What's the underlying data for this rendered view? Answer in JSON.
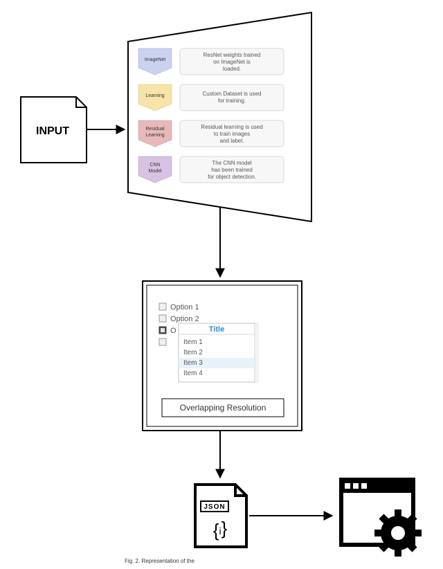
{
  "input": {
    "label": "INPUT"
  },
  "stages": [
    {
      "name": "ImageNet",
      "desc1": "ResNet weights trained",
      "desc2": "on ImageNet is",
      "desc3": "loaded."
    },
    {
      "name": "Learning",
      "desc1": "Custom Dataset is used",
      "desc2": "for training.",
      "desc3": ""
    },
    {
      "name": "Residual",
      "name2": "Learning",
      "desc1": "Residual learning is used",
      "desc2": "to train images",
      "desc3": "and label."
    },
    {
      "name": "CNN",
      "name2": "Model",
      "desc1": "The CNN model",
      "desc2": "has been trained",
      "desc3": "for object detection."
    }
  ],
  "colors": {
    "stage0": "#cbd2f0",
    "stage1": "#f6e4a8",
    "stage2": "#e9b9b9",
    "stage3": "#d7c2e3",
    "descbox": "#f7f7f7",
    "border": "#b3b3b3"
  },
  "options": [
    "Option 1",
    "Option 2",
    "O",
    ""
  ],
  "dropdown": {
    "title": "Title",
    "items": [
      "Item 1",
      "Item 2",
      "Item 3",
      "Item 4"
    ]
  },
  "overlap_label": "Overlapping Resolution",
  "json_icon": {
    "label": "JSON",
    "braces": "{ }"
  },
  "caption": "Fig. 2.  Representation of the"
}
